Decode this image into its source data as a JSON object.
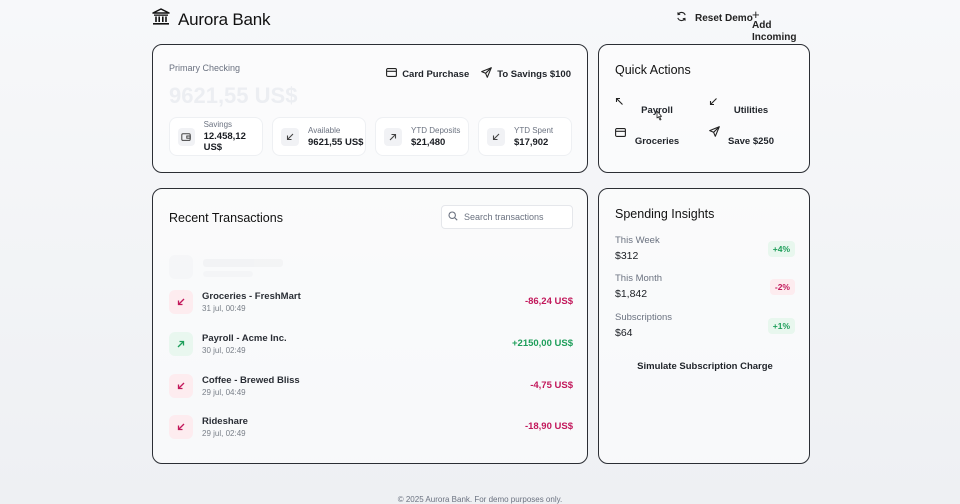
{
  "header": {
    "brand": "Aurora Bank",
    "brand_icon": "bank-icon",
    "reset_label": "Reset Demo",
    "add_label": "Add Incoming"
  },
  "checking": {
    "title": "Primary Checking",
    "balance": "9621,55 US$",
    "actions": [
      {
        "label": "Card Purchase",
        "icon": "credit-card-icon"
      },
      {
        "label": "To Savings $100",
        "icon": "send-icon"
      }
    ],
    "stats": [
      {
        "label": "Savings",
        "value": "12.458,12 US$",
        "icon": "wallet-icon"
      },
      {
        "label": "Available",
        "value": "9621,55 US$",
        "icon": "arrow-down-left-icon"
      },
      {
        "label": "YTD Deposits",
        "value": "$21,480",
        "icon": "arrow-up-right-icon"
      },
      {
        "label": "YTD Spent",
        "value": "$17,902",
        "icon": "arrow-down-left-icon"
      }
    ]
  },
  "quick_actions": {
    "title": "Quick Actions",
    "items": [
      {
        "label": "Payroll",
        "icon": "arrow-up-left-icon"
      },
      {
        "label": "Utilities",
        "icon": "arrow-down-left-icon"
      },
      {
        "label": "Groceries",
        "icon": "credit-card-icon"
      },
      {
        "label": "Save $250",
        "icon": "send-icon"
      }
    ]
  },
  "transactions": {
    "title": "Recent Transactions",
    "search_placeholder": "Search transactions",
    "items": [
      {
        "name": "Groceries - FreshMart",
        "date": "31 jul, 00:49",
        "amount": "-86,24 US$",
        "direction": "out"
      },
      {
        "name": "Payroll - Acme Inc.",
        "date": "30 jul, 02:49",
        "amount": "+2150,00 US$",
        "direction": "in"
      },
      {
        "name": "Coffee - Brewed Bliss",
        "date": "29 jul, 04:49",
        "amount": "-4,75 US$",
        "direction": "out"
      },
      {
        "name": "Rideshare",
        "date": "29 jul, 02:49",
        "amount": "-18,90 US$",
        "direction": "out"
      }
    ]
  },
  "insights": {
    "title": "Spending Insights",
    "rows": [
      {
        "label": "This Week",
        "value": "$312",
        "badge": "+4%",
        "trend": "up"
      },
      {
        "label": "This Month",
        "value": "$1,842",
        "badge": "-2%",
        "trend": "down"
      },
      {
        "label": "Subscriptions",
        "value": "$64",
        "badge": "+1%",
        "trend": "up"
      }
    ],
    "simulate_label": "Simulate Subscription Charge"
  },
  "footer": "© 2025 Aurora Bank. For demo purposes only.",
  "colors": {
    "positive": "#1e9e5a",
    "negative": "#c2185b",
    "border": "#2b2e34"
  }
}
